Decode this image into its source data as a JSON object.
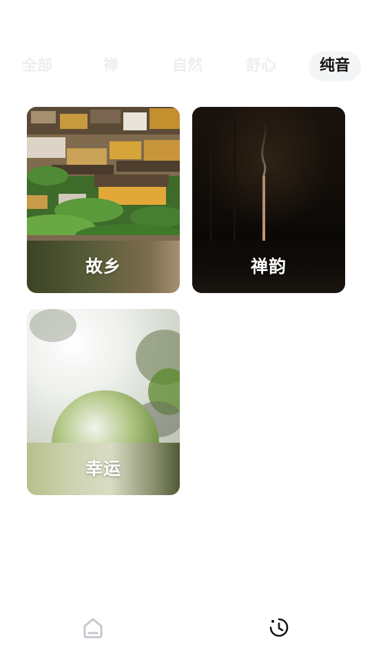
{
  "tabs": [
    {
      "label": "全部",
      "active": false
    },
    {
      "label": "禅",
      "active": false
    },
    {
      "label": "自然",
      "active": false
    },
    {
      "label": "舒心",
      "active": false
    },
    {
      "label": "纯音",
      "active": true
    }
  ],
  "cards": [
    {
      "title": "故乡"
    },
    {
      "title": "禅韵"
    },
    {
      "title": "幸运"
    }
  ],
  "bottom_nav": [
    {
      "icon": "home-icon",
      "active": false
    },
    {
      "icon": "sleep-timer-icon",
      "active": true
    }
  ],
  "colors": {
    "tab_active_text": "#111111",
    "tab_inactive_text": "#eceef1",
    "tab_active_bg": "#f4f5f7",
    "card_title_text": "#ffffff"
  }
}
